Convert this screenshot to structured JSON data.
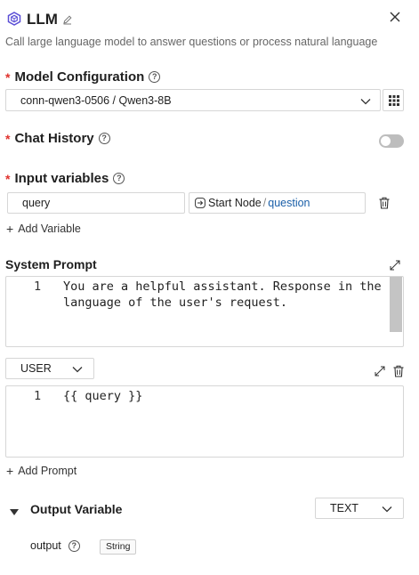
{
  "header": {
    "title": "LLM",
    "description": "Call large language model to answer questions or process natural language",
    "edit_icon": "pencil-icon",
    "close_icon": "close-icon",
    "node_icon": "hexagon-node-icon"
  },
  "model_config": {
    "label": "Model Configuration",
    "required_mark": "*",
    "value": "conn-qwen3-0506 / Qwen3-8B"
  },
  "chat_history": {
    "label": "Chat History",
    "required_mark": "*",
    "enabled": false
  },
  "input_variables": {
    "label": "Input variables",
    "required_mark": "*",
    "rows": [
      {
        "name": "query",
        "source_node": "Start Node",
        "separator": "/",
        "source_field": "question"
      }
    ],
    "add_label": "Add Variable",
    "add_symbol": "+"
  },
  "system_prompt": {
    "label": "System Prompt",
    "lines": [
      {
        "number": "1",
        "text": "You are a helpful assistant. Response in the"
      },
      {
        "number": "",
        "text": "language of the user's request."
      }
    ]
  },
  "user_prompt": {
    "role": "USER",
    "lines": [
      {
        "number": "1",
        "text": "{{ query }}"
      }
    ],
    "add_label": "Add Prompt",
    "add_symbol": "+"
  },
  "output": {
    "label": "Output Variable",
    "format": "TEXT",
    "variable_name": "output",
    "variable_type": "String"
  },
  "colors": {
    "required": "#e0322d",
    "node_icon": "#5b4fd6",
    "link": "#1a5fa8",
    "toggle_off": "#bdbdbd",
    "scrollbar": "#c4c4c4"
  }
}
